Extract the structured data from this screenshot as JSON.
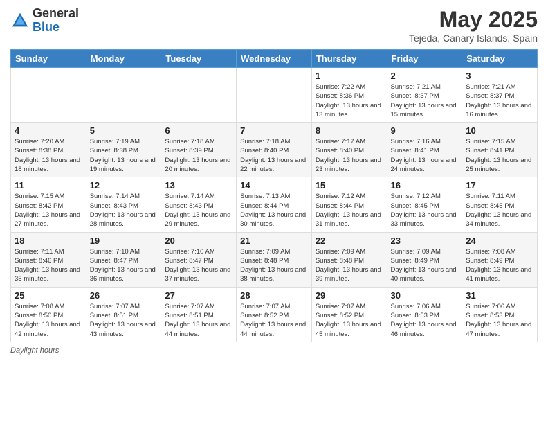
{
  "logo": {
    "general": "General",
    "blue": "Blue"
  },
  "title": "May 2025",
  "subtitle": "Tejeda, Canary Islands, Spain",
  "days_of_week": [
    "Sunday",
    "Monday",
    "Tuesday",
    "Wednesday",
    "Thursday",
    "Friday",
    "Saturday"
  ],
  "footer": {
    "label": "Daylight hours"
  },
  "weeks": [
    [
      {
        "day": "",
        "info": ""
      },
      {
        "day": "",
        "info": ""
      },
      {
        "day": "",
        "info": ""
      },
      {
        "day": "",
        "info": ""
      },
      {
        "day": "1",
        "info": "Sunrise: 7:22 AM\nSunset: 8:36 PM\nDaylight: 13 hours and 13 minutes."
      },
      {
        "day": "2",
        "info": "Sunrise: 7:21 AM\nSunset: 8:37 PM\nDaylight: 13 hours and 15 minutes."
      },
      {
        "day": "3",
        "info": "Sunrise: 7:21 AM\nSunset: 8:37 PM\nDaylight: 13 hours and 16 minutes."
      }
    ],
    [
      {
        "day": "4",
        "info": "Sunrise: 7:20 AM\nSunset: 8:38 PM\nDaylight: 13 hours and 18 minutes."
      },
      {
        "day": "5",
        "info": "Sunrise: 7:19 AM\nSunset: 8:38 PM\nDaylight: 13 hours and 19 minutes."
      },
      {
        "day": "6",
        "info": "Sunrise: 7:18 AM\nSunset: 8:39 PM\nDaylight: 13 hours and 20 minutes."
      },
      {
        "day": "7",
        "info": "Sunrise: 7:18 AM\nSunset: 8:40 PM\nDaylight: 13 hours and 22 minutes."
      },
      {
        "day": "8",
        "info": "Sunrise: 7:17 AM\nSunset: 8:40 PM\nDaylight: 13 hours and 23 minutes."
      },
      {
        "day": "9",
        "info": "Sunrise: 7:16 AM\nSunset: 8:41 PM\nDaylight: 13 hours and 24 minutes."
      },
      {
        "day": "10",
        "info": "Sunrise: 7:15 AM\nSunset: 8:41 PM\nDaylight: 13 hours and 25 minutes."
      }
    ],
    [
      {
        "day": "11",
        "info": "Sunrise: 7:15 AM\nSunset: 8:42 PM\nDaylight: 13 hours and 27 minutes."
      },
      {
        "day": "12",
        "info": "Sunrise: 7:14 AM\nSunset: 8:43 PM\nDaylight: 13 hours and 28 minutes."
      },
      {
        "day": "13",
        "info": "Sunrise: 7:14 AM\nSunset: 8:43 PM\nDaylight: 13 hours and 29 minutes."
      },
      {
        "day": "14",
        "info": "Sunrise: 7:13 AM\nSunset: 8:44 PM\nDaylight: 13 hours and 30 minutes."
      },
      {
        "day": "15",
        "info": "Sunrise: 7:12 AM\nSunset: 8:44 PM\nDaylight: 13 hours and 31 minutes."
      },
      {
        "day": "16",
        "info": "Sunrise: 7:12 AM\nSunset: 8:45 PM\nDaylight: 13 hours and 33 minutes."
      },
      {
        "day": "17",
        "info": "Sunrise: 7:11 AM\nSunset: 8:45 PM\nDaylight: 13 hours and 34 minutes."
      }
    ],
    [
      {
        "day": "18",
        "info": "Sunrise: 7:11 AM\nSunset: 8:46 PM\nDaylight: 13 hours and 35 minutes."
      },
      {
        "day": "19",
        "info": "Sunrise: 7:10 AM\nSunset: 8:47 PM\nDaylight: 13 hours and 36 minutes."
      },
      {
        "day": "20",
        "info": "Sunrise: 7:10 AM\nSunset: 8:47 PM\nDaylight: 13 hours and 37 minutes."
      },
      {
        "day": "21",
        "info": "Sunrise: 7:09 AM\nSunset: 8:48 PM\nDaylight: 13 hours and 38 minutes."
      },
      {
        "day": "22",
        "info": "Sunrise: 7:09 AM\nSunset: 8:48 PM\nDaylight: 13 hours and 39 minutes."
      },
      {
        "day": "23",
        "info": "Sunrise: 7:09 AM\nSunset: 8:49 PM\nDaylight: 13 hours and 40 minutes."
      },
      {
        "day": "24",
        "info": "Sunrise: 7:08 AM\nSunset: 8:49 PM\nDaylight: 13 hours and 41 minutes."
      }
    ],
    [
      {
        "day": "25",
        "info": "Sunrise: 7:08 AM\nSunset: 8:50 PM\nDaylight: 13 hours and 42 minutes."
      },
      {
        "day": "26",
        "info": "Sunrise: 7:07 AM\nSunset: 8:51 PM\nDaylight: 13 hours and 43 minutes."
      },
      {
        "day": "27",
        "info": "Sunrise: 7:07 AM\nSunset: 8:51 PM\nDaylight: 13 hours and 44 minutes."
      },
      {
        "day": "28",
        "info": "Sunrise: 7:07 AM\nSunset: 8:52 PM\nDaylight: 13 hours and 44 minutes."
      },
      {
        "day": "29",
        "info": "Sunrise: 7:07 AM\nSunset: 8:52 PM\nDaylight: 13 hours and 45 minutes."
      },
      {
        "day": "30",
        "info": "Sunrise: 7:06 AM\nSunset: 8:53 PM\nDaylight: 13 hours and 46 minutes."
      },
      {
        "day": "31",
        "info": "Sunrise: 7:06 AM\nSunset: 8:53 PM\nDaylight: 13 hours and 47 minutes."
      }
    ]
  ]
}
